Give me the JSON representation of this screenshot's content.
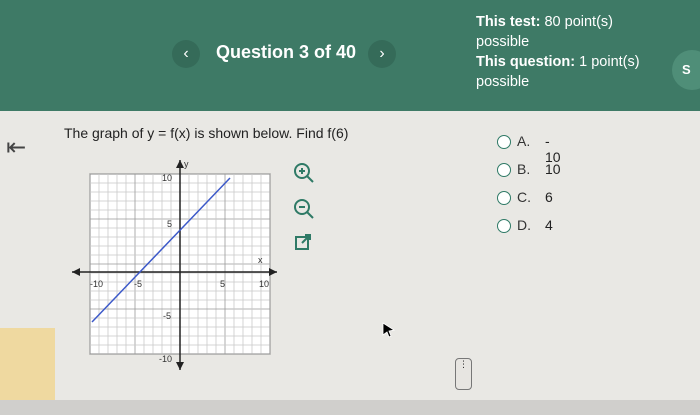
{
  "header": {
    "title": "Question 3 of 40",
    "prev_icon": "‹",
    "next_icon": "›",
    "test_points_label": "This test:",
    "test_points_value": "80 point(s) possible",
    "question_points_label": "This question:",
    "question_points_value": "1 point(s) possible",
    "right_tab": "S"
  },
  "question": {
    "text": "The graph of y = f(x) is shown below. Find f(6)"
  },
  "graph": {
    "x_label": "x",
    "y_label": "y",
    "tick_labels": {
      "neg10x": "-10",
      "neg5x": "-5",
      "pos5x": "5",
      "pos10x": "10",
      "pos10y": "10",
      "pos5y": "5",
      "neg5y": "-5",
      "neg10y": "-10"
    }
  },
  "choices": [
    {
      "letter": "A.",
      "value": "- 10"
    },
    {
      "letter": "B.",
      "value": "10"
    },
    {
      "letter": "C.",
      "value": "6"
    },
    {
      "letter": "D.",
      "value": "4"
    }
  ],
  "handle_icon": "⋮",
  "colors": {
    "header": "#3e7a66",
    "accent": "#2f7a66",
    "line": "#3c59c9"
  }
}
